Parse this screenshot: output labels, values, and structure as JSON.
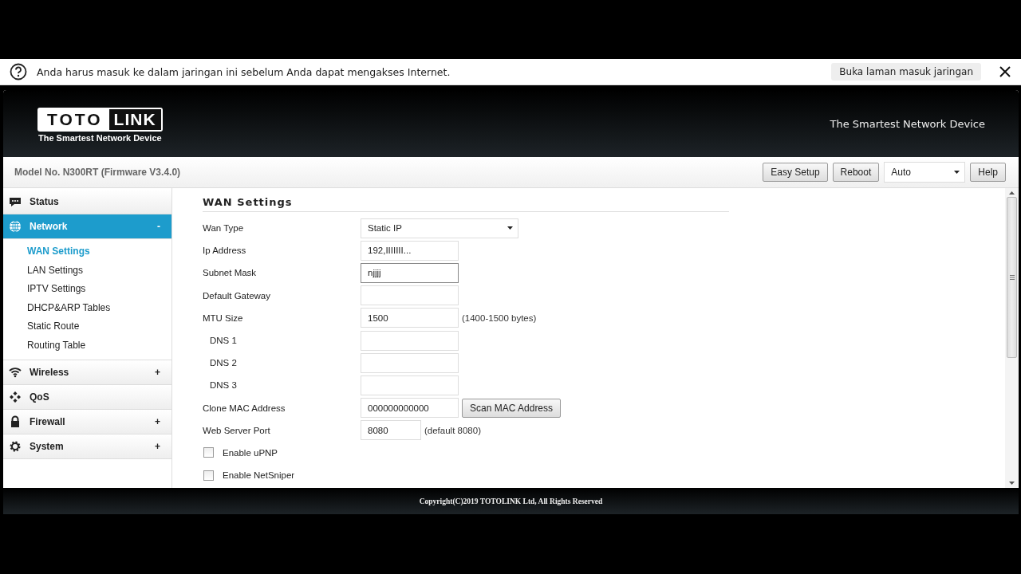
{
  "infobar": {
    "message": "Anda harus masuk ke dalam jaringan ini sebelum Anda dapat mengakses Internet.",
    "action": "Buka laman masuk jaringan"
  },
  "header": {
    "logo_left": "TOTO",
    "logo_right": "LINK",
    "logo_tagline": "The Smartest Network Device",
    "slogan": "The Smartest Network Device"
  },
  "model_bar": {
    "model": "Model No. N300RT (Firmware V3.4.0)",
    "buttons": [
      "Easy Setup",
      "Reboot"
    ],
    "language": "Auto",
    "help": "Help"
  },
  "sidebar": {
    "items": [
      {
        "label": "Status",
        "selected": false
      },
      {
        "label": "Network",
        "sign": "-",
        "selected": true,
        "children": [
          {
            "label": "WAN Settings",
            "selected": true
          },
          {
            "label": "LAN Settings",
            "selected": false
          },
          {
            "label": "IPTV Settings",
            "selected": false
          },
          {
            "label": "DHCP&ARP Tables",
            "selected": false
          },
          {
            "label": "Static Route",
            "selected": false
          },
          {
            "label": "Routing Table",
            "selected": false
          }
        ]
      },
      {
        "label": "Wireless",
        "sign": "+",
        "selected": false
      },
      {
        "label": "QoS",
        "selected": false
      },
      {
        "label": "Firewall",
        "sign": "+",
        "selected": false
      },
      {
        "label": "System",
        "sign": "+",
        "selected": false
      }
    ]
  },
  "form": {
    "title": "WAN Settings",
    "rows": [
      {
        "kind": "select",
        "label": "Wan Type",
        "value": "Static IP"
      },
      {
        "kind": "input",
        "label": "Ip Address",
        "value": "192,IIIIIII..."
      },
      {
        "kind": "input",
        "label": "Subnet Mask",
        "value": "njjjj",
        "focused": true
      },
      {
        "kind": "input",
        "label": "Default Gateway"
      },
      {
        "kind": "input",
        "label": "MTU Size",
        "value": "1500",
        "note": "(1400-1500 bytes)"
      },
      {
        "kind": "subinput",
        "label": "DNS 1"
      },
      {
        "kind": "subinput",
        "label": "DNS 2"
      },
      {
        "kind": "subinput",
        "label": "DNS 3"
      },
      {
        "kind": "input",
        "label": "Clone MAC Address",
        "value": "000000000000",
        "button": "Scan MAC Address"
      },
      {
        "kind": "short",
        "label": "Web Server Port",
        "value": "8080",
        "note": "(default 8080)"
      },
      {
        "kind": "checkbox",
        "label": "Enable uPNP",
        "checked": false
      },
      {
        "kind": "checkbox",
        "label": "Enable NetSniper",
        "checked": false
      }
    ]
  },
  "footer": {
    "copyright": "Copyright(C)2019 TOTOLINK Ltd, All Rights Reserved"
  }
}
